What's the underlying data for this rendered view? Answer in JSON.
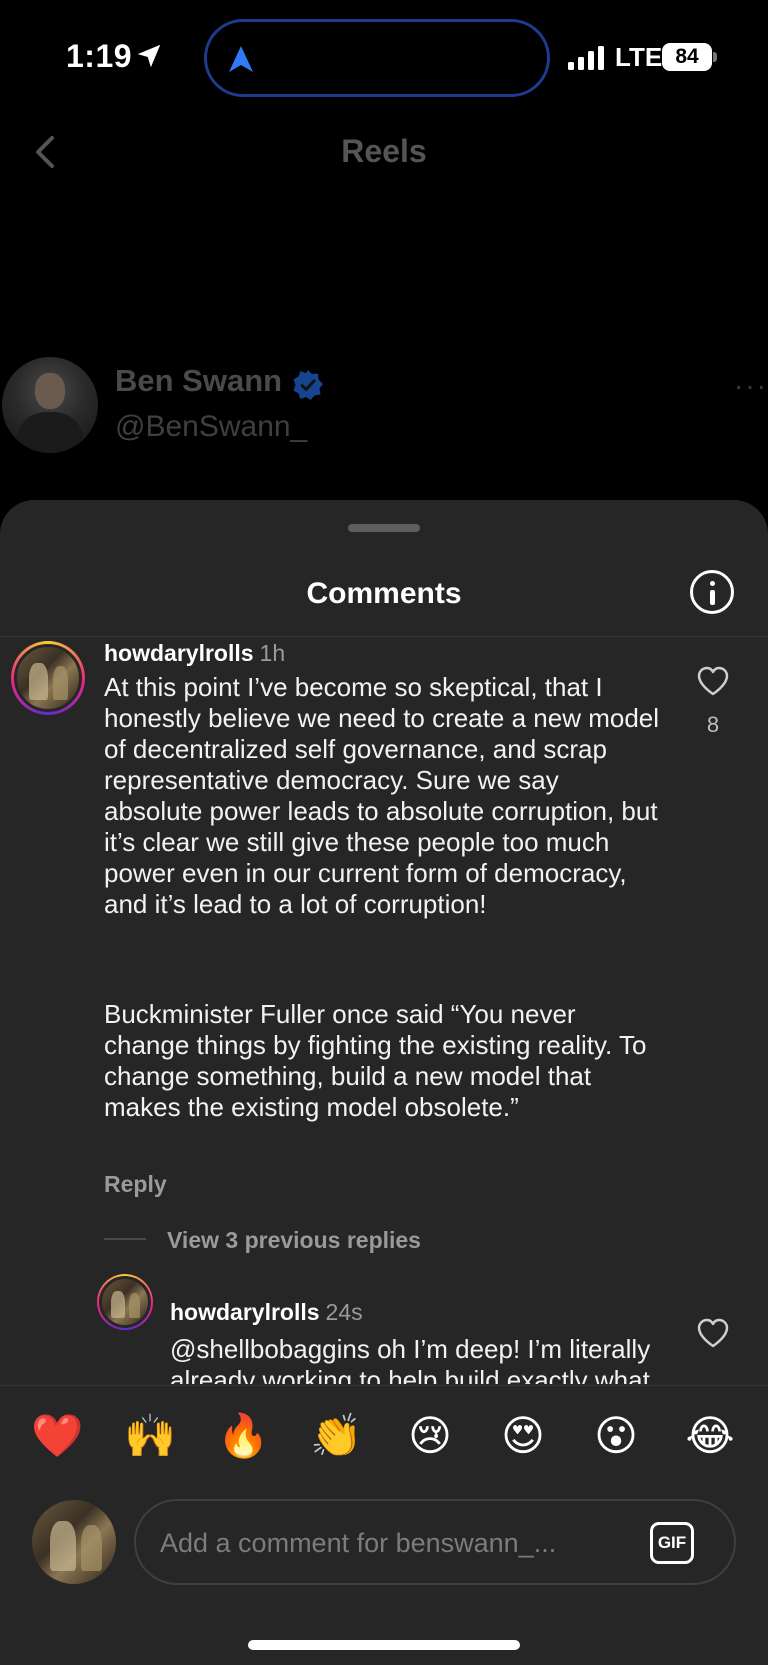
{
  "status_bar": {
    "time": "1:19",
    "network": "LTE",
    "battery": "84"
  },
  "header": {
    "title": "Reels"
  },
  "profile": {
    "name": "Ben Swann",
    "handle": "@BenSwann_",
    "more": "···"
  },
  "comments_sheet": {
    "title": "Comments",
    "comments": [
      {
        "user": "howdarylrolls",
        "time": "1h",
        "paragraphs": [
          "At this point I’ve become so skeptical, that I honestly believe we need to create a new model of decentralized self governance, and scrap representative democracy.  Sure we say absolute power leads to absolute corruption, but it’s clear we still give these people too much power even in our current form of democracy, and it’s lead to a lot of corruption!",
          "Buckminister Fuller once said “You never change things by fighting the existing reality. To change something, build a new model that makes the existing model obsolete.”"
        ],
        "reply_label": "Reply",
        "like_count": "8",
        "view_replies": "View 3 previous replies"
      },
      {
        "user": "howdarylrolls",
        "time": "24s",
        "text": "@shellbobaggins oh I’m deep!  I’m literally already working to help build exactly what I’m talking about.  Look"
      }
    ]
  },
  "emoji_bar": {
    "emojis": [
      "❤️",
      "🙌",
      "🔥",
      "👏",
      "😢",
      "😍",
      "😮",
      "😂"
    ]
  },
  "composer": {
    "placeholder": "Add a comment for benswann_...",
    "gif_label": "GIF"
  },
  "colors": {
    "background": "#000000",
    "sheet": "#262626",
    "verified_blue": "#1877f2",
    "island_border": "#1d3b8f"
  }
}
